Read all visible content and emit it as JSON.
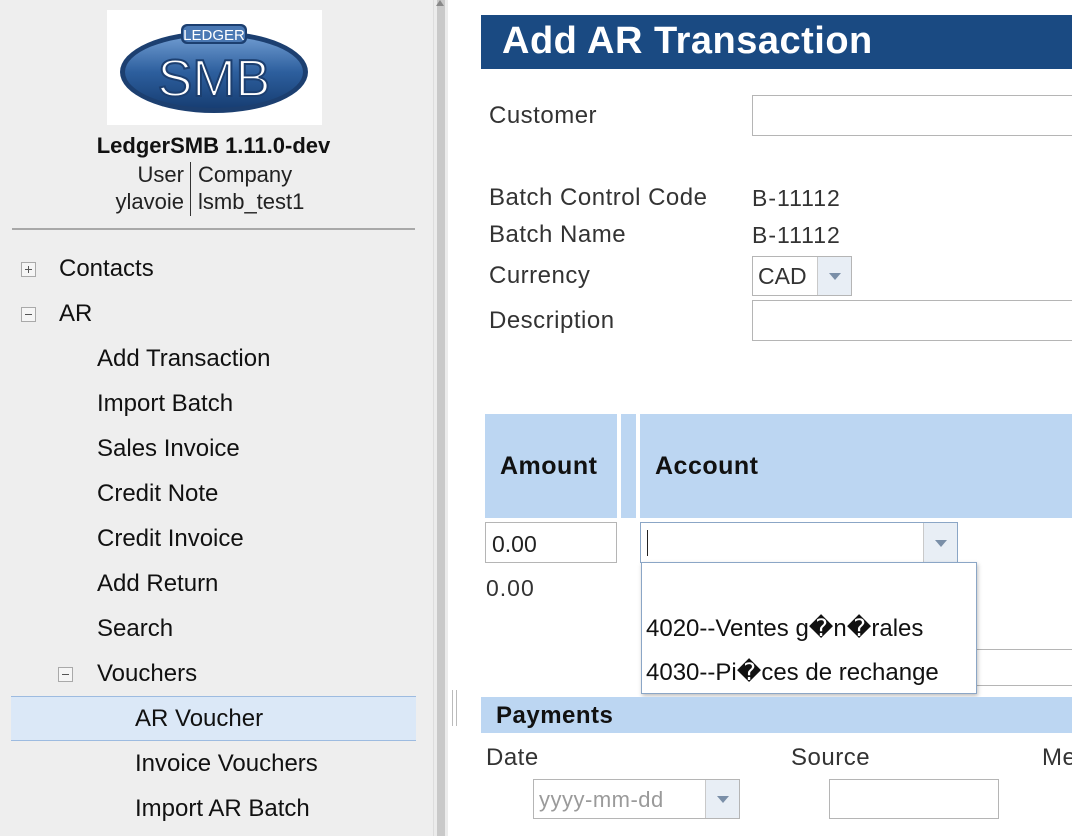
{
  "sidebar": {
    "logo": {
      "top_text": "LEDGER",
      "main_text": "SMB"
    },
    "version": "LedgerSMB 1.11.0-dev",
    "user_label": "User",
    "user_value": "ylavoie",
    "company_label": "Company",
    "company_value": "lsmb_test1",
    "menu": [
      {
        "label": "Contacts",
        "toggle": "expand"
      },
      {
        "label": "AR",
        "toggle": "collapse"
      },
      {
        "label": "Add Transaction"
      },
      {
        "label": "Import Batch"
      },
      {
        "label": "Sales Invoice"
      },
      {
        "label": "Credit Note"
      },
      {
        "label": "Credit Invoice"
      },
      {
        "label": "Add Return"
      },
      {
        "label": "Search"
      },
      {
        "label": "Vouchers",
        "toggle": "collapse"
      },
      {
        "label": "AR Voucher",
        "selected": true
      },
      {
        "label": "Invoice Vouchers"
      },
      {
        "label": "Import AR Batch"
      }
    ]
  },
  "main": {
    "title": "Add AR Transaction",
    "customer_label": "Customer",
    "customer_value": "",
    "batch_control_label": "Batch Control Code",
    "batch_control_value": "B-11112",
    "batch_name_label": "Batch Name",
    "batch_name_value": "B-11112",
    "currency_label": "Currency",
    "currency_value": "CAD",
    "description_label": "Description",
    "description_value": "",
    "grid": {
      "amount_header": "Amount",
      "account_header": "Account",
      "amount_value": "0.00",
      "amount_total": "0.00",
      "account_value": "",
      "account_options": [
        "",
        "4020--Ventes g�n�rales",
        "4030--Pi�ces de rechange"
      ]
    },
    "payments": {
      "title": "Payments",
      "date_label": "Date",
      "date_placeholder": "yyyy-mm-dd",
      "source_label": "Source",
      "memo_label": "Me"
    }
  },
  "colors": {
    "title_bar": "#1a4a82",
    "header_bg": "#bcd6f2",
    "selected_bg": "#dbe8f7",
    "sidebar_bg": "#eeeeee"
  }
}
